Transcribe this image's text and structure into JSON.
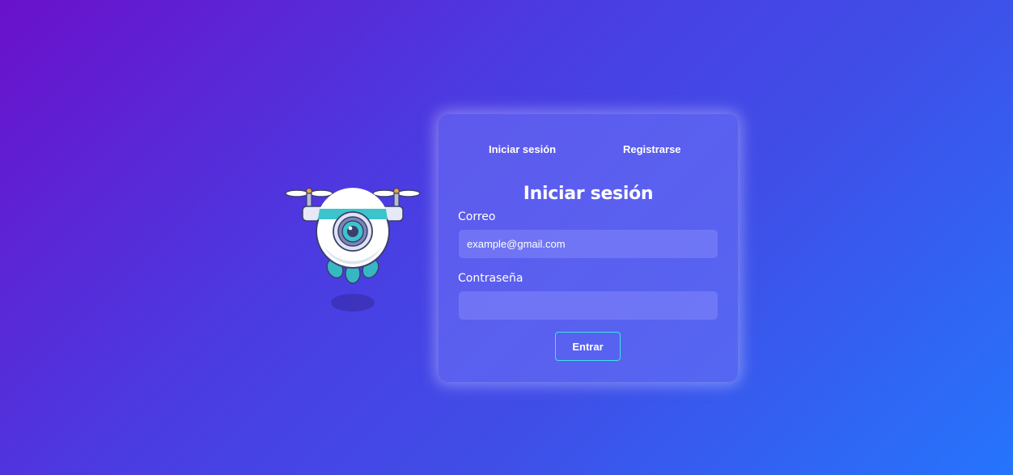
{
  "tabs": {
    "login_label": "Iniciar sesión",
    "register_label": "Registrarse"
  },
  "form": {
    "title": "Iniciar sesión",
    "email_label": "Correo",
    "email_value": "example@gmail.com",
    "password_label": "Contraseña",
    "password_value": "",
    "submit_label": "Entrar"
  },
  "colors": {
    "background_start": "#6a11cb",
    "background_end": "#2575fc",
    "button_border": "#3fe0e8"
  },
  "illustration": {
    "icon": "camera-drone-icon"
  }
}
